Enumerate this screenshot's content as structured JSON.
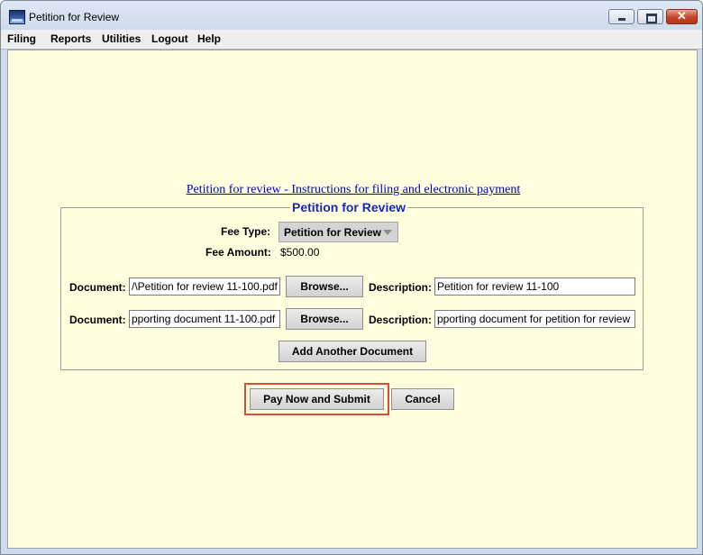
{
  "window": {
    "title": "Petition for Review"
  },
  "menu": [
    "Filing",
    "Reports",
    "Utilities",
    "Logout",
    "Help"
  ],
  "instructions_link": "Petition for review - Instructions for filing and electronic payment",
  "form": {
    "group_title": "Petition for Review",
    "fee_type_label": "Fee Type:",
    "fee_type_value": "Petition for Review",
    "fee_amount_label": "Fee Amount:",
    "fee_amount_value": "$500.00",
    "documents": [
      {
        "document_label": "Document:",
        "document_value": "/\\Petition for review 11-100.pdf",
        "browse_label": "Browse...",
        "description_label": "Description:",
        "description_value": "Petition for review 11-100"
      },
      {
        "document_label": "Document:",
        "document_value": "pporting document 11-100.pdf",
        "browse_label": "Browse...",
        "description_label": "Description:",
        "description_value": "pporting document for petition for review"
      }
    ],
    "add_document_label": "Add Another Document"
  },
  "actions": {
    "pay_submit_label": "Pay Now and Submit",
    "cancel_label": "Cancel"
  },
  "colors": {
    "content_background": "#ffffe0",
    "link": "#0000cc",
    "group_title": "#1a28b8",
    "highlight": "#e04a3a"
  }
}
